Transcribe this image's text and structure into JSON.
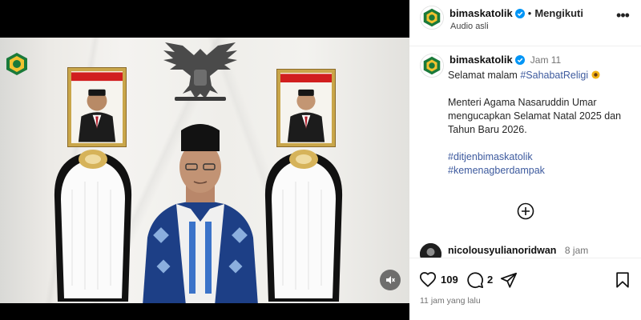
{
  "post": {
    "username": "bimaskatolik",
    "follow_label": "Mengikuti",
    "audio_label": "Audio asli",
    "more_label": "•••"
  },
  "caption": {
    "username": "bimaskatolik",
    "time": "Jam 11",
    "greeting": "Selamat malam",
    "greeting_tag": "#SahabatReligi",
    "body": "Menteri Agama Nasaruddin Umar mengucapkan Selamat Natal 2025 dan Tahun Baru 2026.",
    "hashtag1": "#ditjenbimaskatolik",
    "hashtag2": "#kemenagberdampak"
  },
  "comment": {
    "username": "nicolousyulianoridwan",
    "time": "8 jam"
  },
  "actions": {
    "likes": "109",
    "comments": "2",
    "posted_ago": "11 jam yang lalu"
  },
  "colors": {
    "hashtag": "#3d5a9e",
    "verified": "#0095f6",
    "muted_text": "#737373"
  },
  "icons": [
    "kemenag-logo-icon",
    "verified-icon",
    "more-options-icon",
    "sunflower-icon",
    "add-comments-icon",
    "heart-icon",
    "comment-icon",
    "share-icon",
    "bookmark-icon",
    "mute-icon"
  ]
}
